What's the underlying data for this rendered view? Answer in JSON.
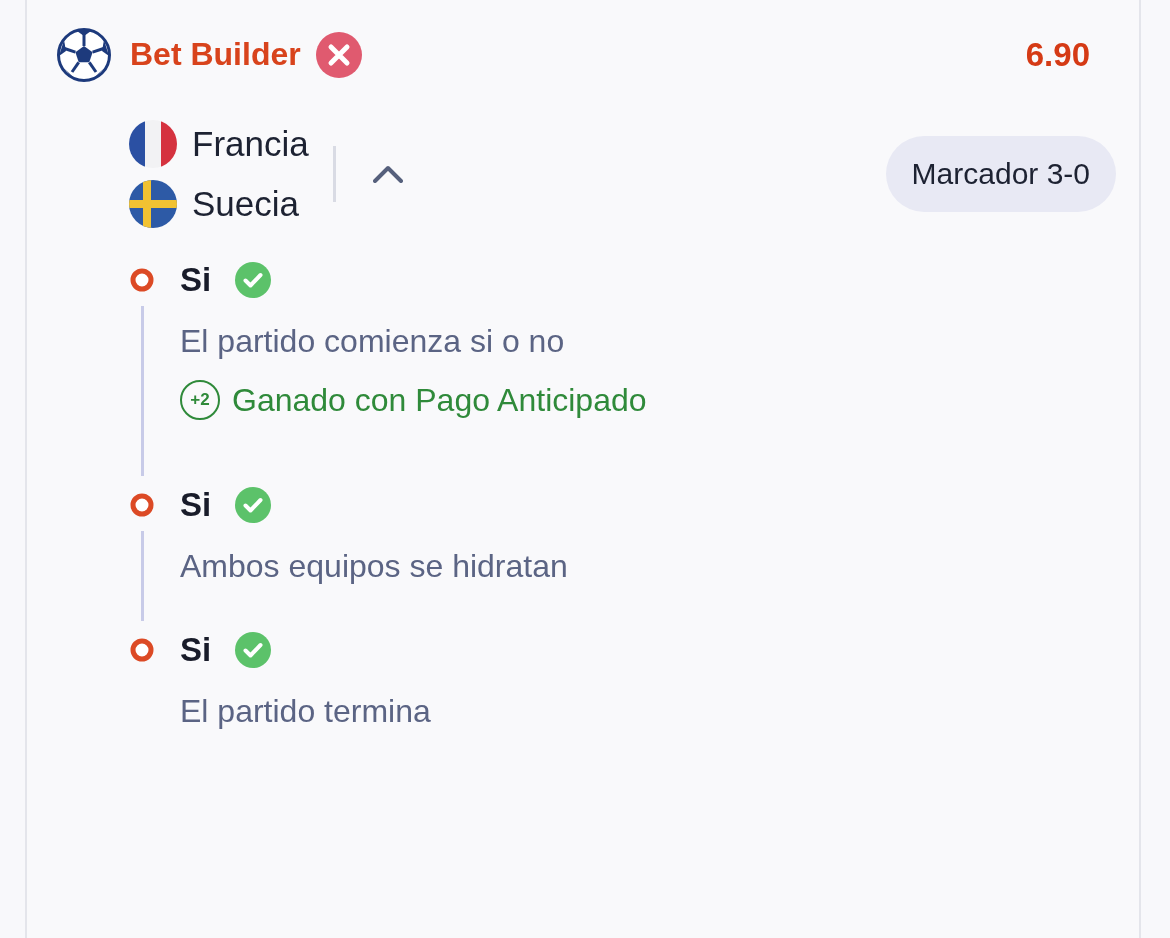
{
  "bet": {
    "title": "Bet Builder",
    "won": false,
    "odds": "6.90"
  },
  "match": {
    "teams": [
      {
        "name": "Francia",
        "kind": "france"
      },
      {
        "name": "Suecia",
        "kind": "sweden"
      }
    ],
    "expanded": true,
    "score": "Marcador 3-0"
  },
  "selections": [
    {
      "pick": "Si",
      "won": true,
      "description": "El partido comienza si o no",
      "note": {
        "badge": "+2",
        "text": "Ganado con Pago Anticipado"
      }
    },
    {
      "pick": "Si",
      "won": true,
      "description": "Ambos equipos se hidratan"
    },
    {
      "pick": "Si",
      "won": true,
      "description": "El partido termina"
    }
  ]
}
